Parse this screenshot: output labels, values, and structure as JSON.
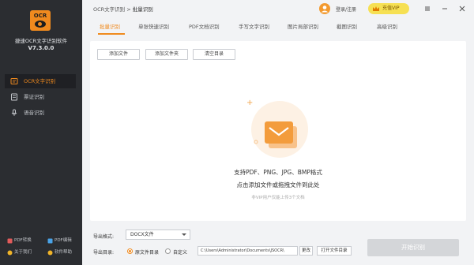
{
  "app": {
    "logo_text": "OCR",
    "name": "捷速OCR文字识别软件",
    "version": "V7.3.0.0"
  },
  "sidebar": {
    "items": [
      {
        "label": "OCR文字识别",
        "icon": "image-text-icon",
        "active": true
      },
      {
        "label": "票证识别",
        "icon": "ticket-icon",
        "active": false
      },
      {
        "label": "语音识别",
        "icon": "microphone-icon",
        "active": false
      }
    ],
    "bottom_links": [
      {
        "label": "PDF转换",
        "icon": "pdf-convert-icon"
      },
      {
        "label": "PDF编辑",
        "icon": "pdf-edit-icon"
      },
      {
        "label": "关于我们",
        "icon": "info-icon"
      },
      {
        "label": "软件帮助",
        "icon": "help-icon"
      }
    ]
  },
  "header": {
    "breadcrumb_root": "OCR文字识别",
    "breadcrumb_sep": ">",
    "breadcrumb_current": "批量识别",
    "login_label": "登录/注册",
    "vip_label": "充值VIP"
  },
  "tabs": [
    "批量识别",
    "单张快速识别",
    "PDF文档识别",
    "手写文字识别",
    "图片局部识别",
    "截图识别",
    "高级识别"
  ],
  "active_tab": 0,
  "toolbar": {
    "add_file": "添加文件",
    "add_folder": "添加文件夹",
    "clear_list": "清空目录"
  },
  "dropzone": {
    "line1": "支持PDF、PNG、JPG、BMP格式",
    "line2": "点击添加文件或拖拽文件到此处",
    "hint": "非VIP用户仅能上传3个文档"
  },
  "output": {
    "format_label": "导出格式:",
    "format_value": "DOCX文件",
    "dir_label": "导出目录:",
    "radio_source": "原文件目录",
    "radio_custom": "自定义",
    "path": "C:\\Users\\Administrator\\Documents\\JSOCR\\",
    "change_btn": "更改",
    "open_btn": "打开文件目录",
    "start_btn": "开始识别"
  },
  "colors": {
    "accent": "#f08a1e",
    "sidebar_bg": "#2b2d31",
    "vip_bg": "#f6e053"
  }
}
